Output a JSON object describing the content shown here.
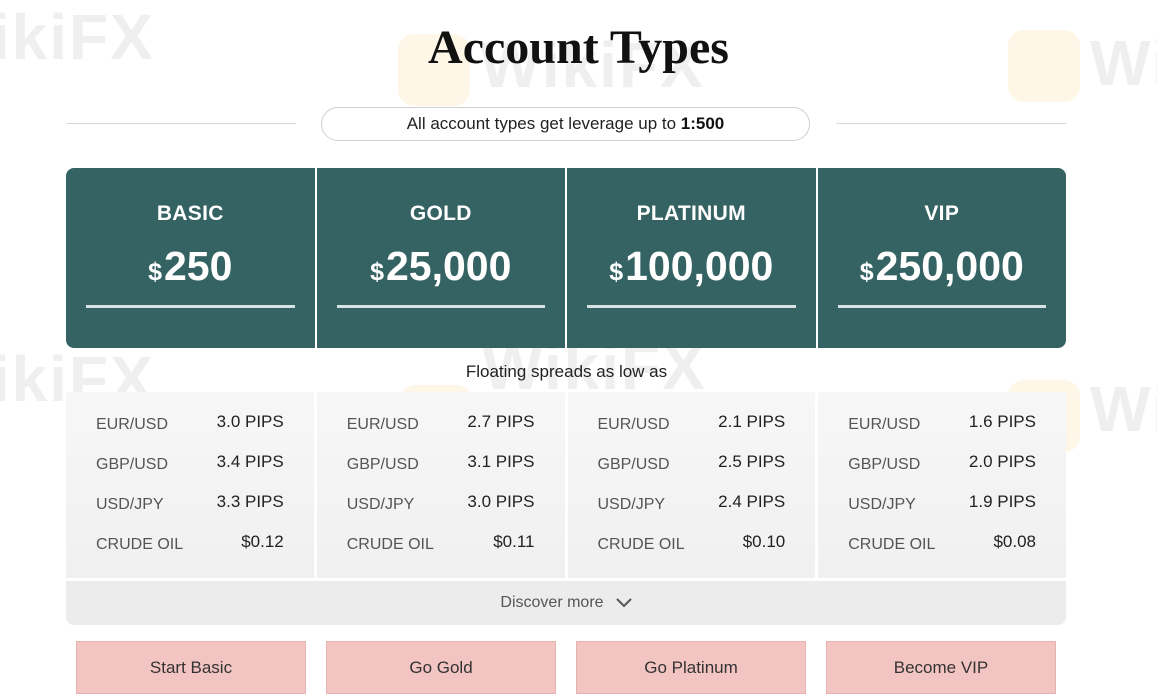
{
  "title": "Account Types",
  "leverage": {
    "text": "All account types get leverage up to ",
    "value": "1:500"
  },
  "currency_symbol": "$",
  "plans": [
    {
      "name": "BASIC",
      "price": "250"
    },
    {
      "name": "GOLD",
      "price": "25,000"
    },
    {
      "name": "PLATINUM",
      "price": "100,000"
    },
    {
      "name": "VIP",
      "price": "250,000"
    }
  ],
  "floating_label": "Floating spreads as low as",
  "spreads": [
    {
      "rows": [
        {
          "pair": "EUR/USD",
          "value": "3.0 PIPS"
        },
        {
          "pair": "GBP/USD",
          "value": "3.4 PIPS"
        },
        {
          "pair": "USD/JPY",
          "value": "3.3 PIPS"
        },
        {
          "pair": "CRUDE OIL",
          "value": "$0.12"
        }
      ]
    },
    {
      "rows": [
        {
          "pair": "EUR/USD",
          "value": "2.7 PIPS"
        },
        {
          "pair": "GBP/USD",
          "value": "3.1 PIPS"
        },
        {
          "pair": "USD/JPY",
          "value": "3.0 PIPS"
        },
        {
          "pair": "CRUDE OIL",
          "value": "$0.11"
        }
      ]
    },
    {
      "rows": [
        {
          "pair": "EUR/USD",
          "value": "2.1 PIPS"
        },
        {
          "pair": "GBP/USD",
          "value": "2.5 PIPS"
        },
        {
          "pair": "USD/JPY",
          "value": "2.4 PIPS"
        },
        {
          "pair": "CRUDE OIL",
          "value": "$0.10"
        }
      ]
    },
    {
      "rows": [
        {
          "pair": "EUR/USD",
          "value": "1.6 PIPS"
        },
        {
          "pair": "GBP/USD",
          "value": "2.0 PIPS"
        },
        {
          "pair": "USD/JPY",
          "value": "1.9 PIPS"
        },
        {
          "pair": "CRUDE OIL",
          "value": "$0.08"
        }
      ]
    }
  ],
  "discover_label": "Discover more",
  "buttons": [
    "Start Basic",
    "Go Gold",
    "Go Platinum",
    "Become VIP"
  ],
  "watermark": "WikiFX",
  "colors": {
    "plan_bg": "#356262",
    "button_bg": "#f2c4c2",
    "panel_bg": "#f3f3f3"
  }
}
